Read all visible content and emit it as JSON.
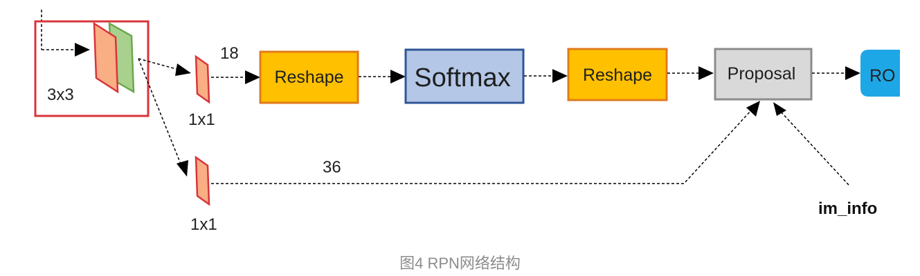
{
  "diagram": {
    "conv_label": "3x3",
    "branch1_kernel": "1x1",
    "branch2_kernel": "1x1",
    "branch1_channels": "18",
    "branch2_channels": "36",
    "reshape1": "Reshape",
    "softmax": "Softmax",
    "reshape2": "Reshape",
    "proposal": "Proposal",
    "roi_truncated": "RO",
    "im_info": "im_info"
  },
  "caption": "图4 RPN网络结构",
  "colors": {
    "conv_box_border": "#d9343a",
    "orange_fill": "#f9ae84",
    "orange_border": "#d9343a",
    "green_fill": "#a9d18e",
    "green_border": "#6aa84f",
    "reshape_fill": "#ffc000",
    "reshape_border": "#e07b1a",
    "softmax_fill": "#b4c7e7",
    "softmax_border": "#2f5597",
    "proposal_fill": "#d9d9d9",
    "proposal_border": "#8c8c8c",
    "roi_fill": "#1ea7e6"
  }
}
